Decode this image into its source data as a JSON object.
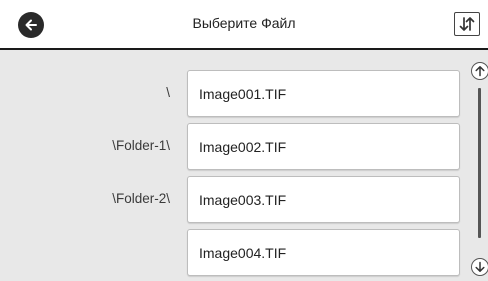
{
  "header": {
    "title": "Выберите Файл",
    "back_icon": "back-arrow-icon",
    "sort_icon": "sort-updown-icon"
  },
  "files": [
    {
      "path": "\\",
      "name": "Image001.TIF"
    },
    {
      "path": "\\Folder-1\\",
      "name": "Image002.TIF"
    },
    {
      "path": "\\Folder-2\\",
      "name": "Image003.TIF"
    },
    {
      "path": "",
      "name": "Image004.TIF"
    }
  ],
  "scroll": {
    "up_icon": "scroll-up-icon",
    "down_icon": "scroll-down-icon"
  },
  "colors": {
    "background": "#e8e8e8",
    "header": "#ffffff",
    "accent": "#2a2a2a"
  }
}
